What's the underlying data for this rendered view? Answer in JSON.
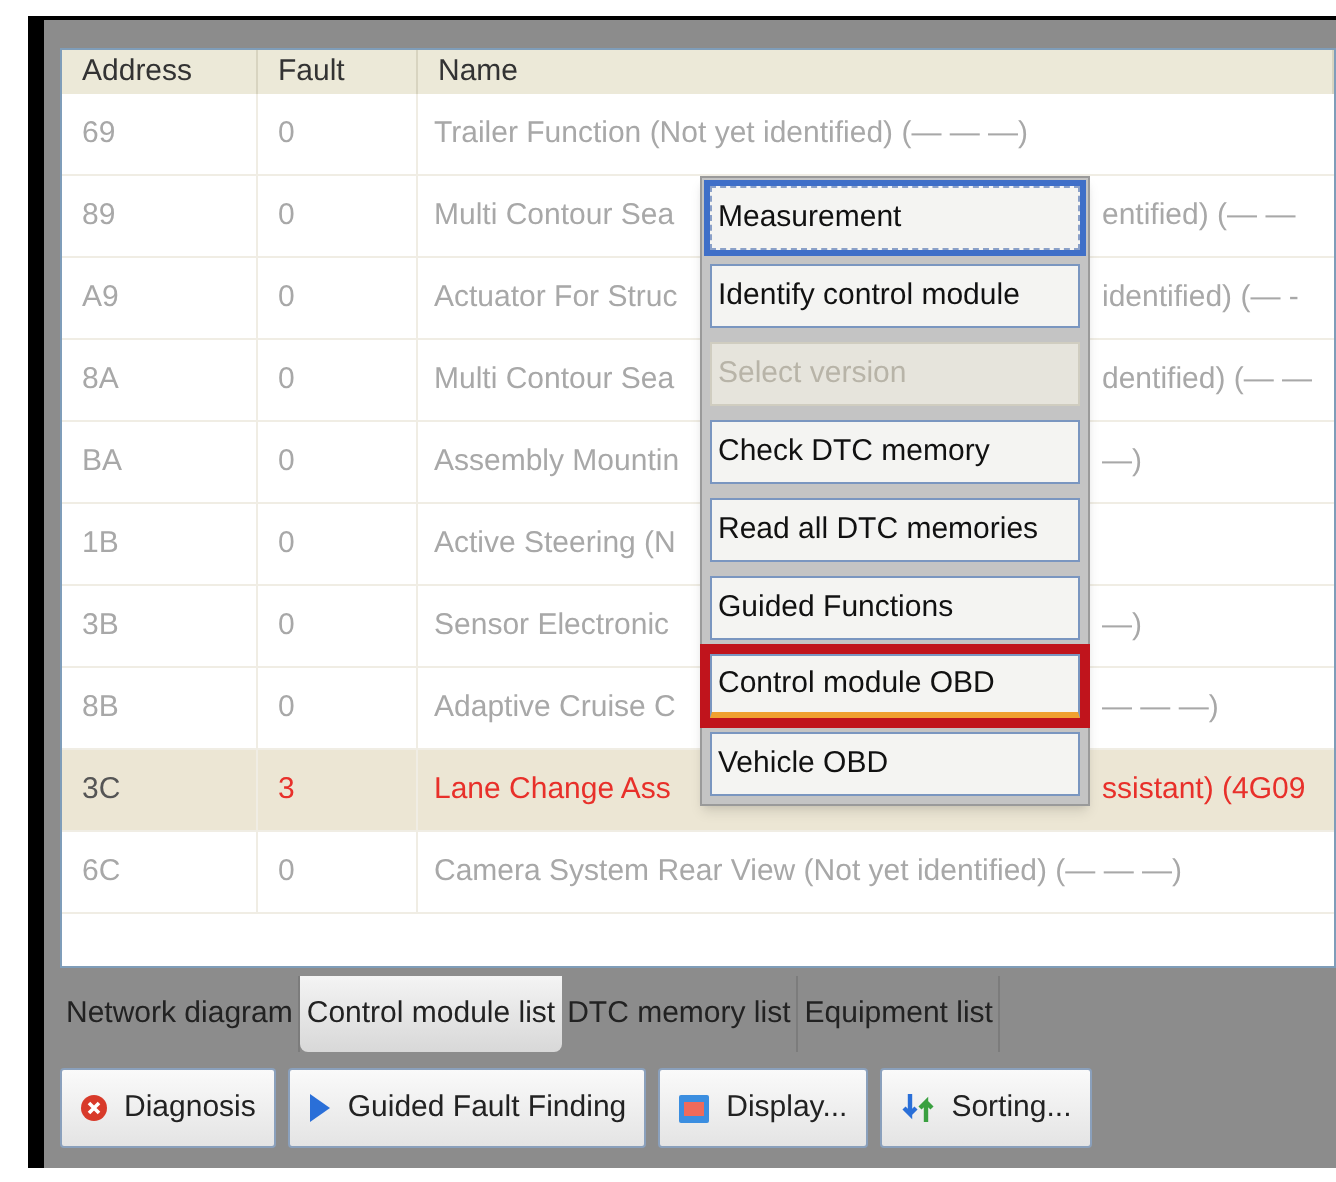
{
  "table": {
    "columns": [
      "Address",
      "Fault",
      "Name"
    ],
    "rows": [
      {
        "address": "69",
        "fault": "0",
        "name": "Trailer Function (Not yet identified) (—  —  —)",
        "selected": false
      },
      {
        "address": "89",
        "fault": "0",
        "name": "Multi Contour Sea",
        "name_end": "entified) (—  —",
        "selected": false
      },
      {
        "address": "A9",
        "fault": "0",
        "name": "Actuator For Struc",
        "name_end": "identified) (—  -",
        "selected": false
      },
      {
        "address": "8A",
        "fault": "0",
        "name": "Multi Contour Sea",
        "name_end": "dentified) (—  —",
        "selected": false
      },
      {
        "address": "BA",
        "fault": "0",
        "name": "Assembly Mountin",
        "name_end": "—)",
        "selected": false
      },
      {
        "address": "1B",
        "fault": "0",
        "name": "Active Steering (N",
        "selected": false
      },
      {
        "address": "3B",
        "fault": "0",
        "name": "Sensor Electronic",
        "name_end": "—)",
        "selected": false
      },
      {
        "address": "8B",
        "fault": "0",
        "name": "Adaptive Cruise C",
        "name_end": "—  —  —)",
        "selected": false
      },
      {
        "address": "3C",
        "fault": "3",
        "name": "Lane Change Ass",
        "name_end": "ssistant) (4G09",
        "selected": true
      },
      {
        "address": "6C",
        "fault": "0",
        "name": "Camera System Rear View (Not yet identified) (—  —  —)",
        "selected": false
      }
    ]
  },
  "context_menu": [
    {
      "label": "Measurement",
      "focused": true,
      "disabled": false,
      "highlighted": false
    },
    {
      "label": "Identify control module",
      "focused": false,
      "disabled": false,
      "highlighted": false
    },
    {
      "label": "Select version",
      "focused": false,
      "disabled": true,
      "highlighted": false
    },
    {
      "label": "Check DTC memory",
      "focused": false,
      "disabled": false,
      "highlighted": false
    },
    {
      "label": "Read all DTC memories",
      "focused": false,
      "disabled": false,
      "highlighted": false
    },
    {
      "label": "Guided Functions",
      "focused": false,
      "disabled": false,
      "highlighted": false
    },
    {
      "label": "Control module OBD",
      "focused": false,
      "disabled": false,
      "highlighted": true
    },
    {
      "label": "Vehicle OBD",
      "focused": false,
      "disabled": false,
      "highlighted": false
    }
  ],
  "tabs": [
    {
      "label": "Network diagram",
      "selected": false
    },
    {
      "label": "Control module list",
      "selected": true
    },
    {
      "label": "DTC memory list",
      "selected": false
    },
    {
      "label": "Equipment list",
      "selected": false
    }
  ],
  "buttons": [
    {
      "label": "Diagnosis",
      "kind": "stop"
    },
    {
      "label": "Guided Fault Finding",
      "kind": "play"
    },
    {
      "label": "Display...",
      "kind": "display"
    },
    {
      "label": "Sorting...",
      "kind": "sort"
    }
  ]
}
